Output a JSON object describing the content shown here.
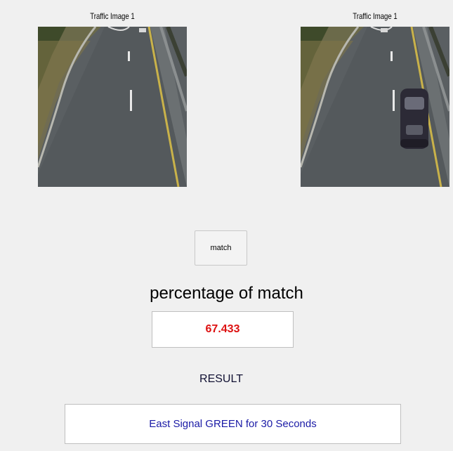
{
  "left_image": {
    "title": "Traffic Image 1"
  },
  "right_image": {
    "title": "Traffic Image 1"
  },
  "match_button": {
    "label": "match"
  },
  "percentage": {
    "label": "percentage of match",
    "value": "67.433",
    "value_color": "#dd1111"
  },
  "result": {
    "label": "RESULT",
    "value": "East Signal GREEN for 30 Seconds",
    "value_color": "#1a1aa6"
  }
}
